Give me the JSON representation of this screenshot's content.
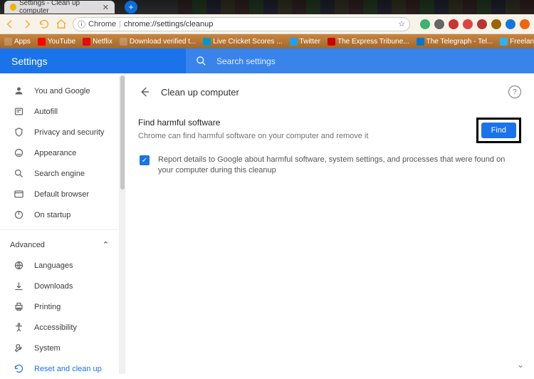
{
  "tab": {
    "title": "Settings - Clean up computer"
  },
  "address": {
    "scheme": "Chrome",
    "url": "chrome://settings/cleanup"
  },
  "bookmarks": [
    {
      "label": "Apps"
    },
    {
      "label": "YouTube"
    },
    {
      "label": "Netflix"
    },
    {
      "label": "Download verified t..."
    },
    {
      "label": "Live Cricket Scores ..."
    },
    {
      "label": "Twitter"
    },
    {
      "label": "The Express Tribune..."
    },
    {
      "label": "The Telegraph - Tel..."
    },
    {
      "label": "Freelancer.com"
    }
  ],
  "header": {
    "title": "Settings",
    "search_placeholder": "Search settings"
  },
  "sidebar": {
    "items": [
      {
        "label": "You and Google",
        "name": "sidebar-item-you"
      },
      {
        "label": "Autofill",
        "name": "sidebar-item-autofill"
      },
      {
        "label": "Privacy and security",
        "name": "sidebar-item-privacy"
      },
      {
        "label": "Appearance",
        "name": "sidebar-item-appearance"
      },
      {
        "label": "Search engine",
        "name": "sidebar-item-search"
      },
      {
        "label": "Default browser",
        "name": "sidebar-item-default"
      },
      {
        "label": "On startup",
        "name": "sidebar-item-startup"
      }
    ],
    "advanced_label": "Advanced",
    "advanced_items": [
      {
        "label": "Languages",
        "name": "sidebar-item-languages"
      },
      {
        "label": "Downloads",
        "name": "sidebar-item-downloads"
      },
      {
        "label": "Printing",
        "name": "sidebar-item-printing"
      },
      {
        "label": "Accessibility",
        "name": "sidebar-item-accessibility"
      },
      {
        "label": "System",
        "name": "sidebar-item-system"
      },
      {
        "label": "Reset and clean up",
        "name": "sidebar-item-reset",
        "active": true
      }
    ]
  },
  "content": {
    "title": "Clean up computer",
    "section_title": "Find harmful software",
    "section_desc": "Chrome can find harmful software on your computer and remove it",
    "find_label": "Find",
    "checkbox_desc": "Report details to Google about harmful software, system settings, and processes that were found on your computer during this cleanup"
  }
}
